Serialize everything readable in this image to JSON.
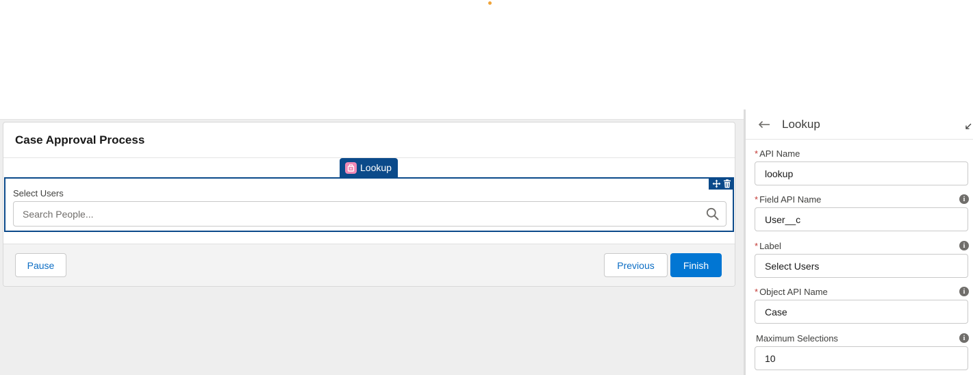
{
  "flow": {
    "title": "Case Approval Process",
    "component_tag": "Lookup",
    "field_label": "Select Users",
    "search_placeholder": "Search People..."
  },
  "footer": {
    "pause_label": "Pause",
    "previous_label": "Previous",
    "finish_label": "Finish"
  },
  "panel": {
    "title": "Lookup",
    "fields": [
      {
        "label": "API Name",
        "required": "*",
        "value": "lookup"
      },
      {
        "label": "Field API Name",
        "required": "*",
        "value": "User__c"
      },
      {
        "label": "Label",
        "required": "*",
        "value": "Select Users"
      },
      {
        "label": "Object API Name",
        "required": "*",
        "value": "Case"
      },
      {
        "label": "Maximum Selections",
        "required": "",
        "value": "10"
      }
    ]
  },
  "icons": {
    "tag_icon": "lookup-component-icon",
    "move": "move-icon",
    "delete": "trash-icon",
    "search": "search-icon",
    "back": "back-arrow-icon",
    "expand": "expand-icon",
    "info": "info-icon"
  },
  "colors": {
    "brand_blue": "#0176d3",
    "selection_navy": "#0b4a8a",
    "required_red": "#c23934",
    "tag_pink": "#f08ab6"
  }
}
